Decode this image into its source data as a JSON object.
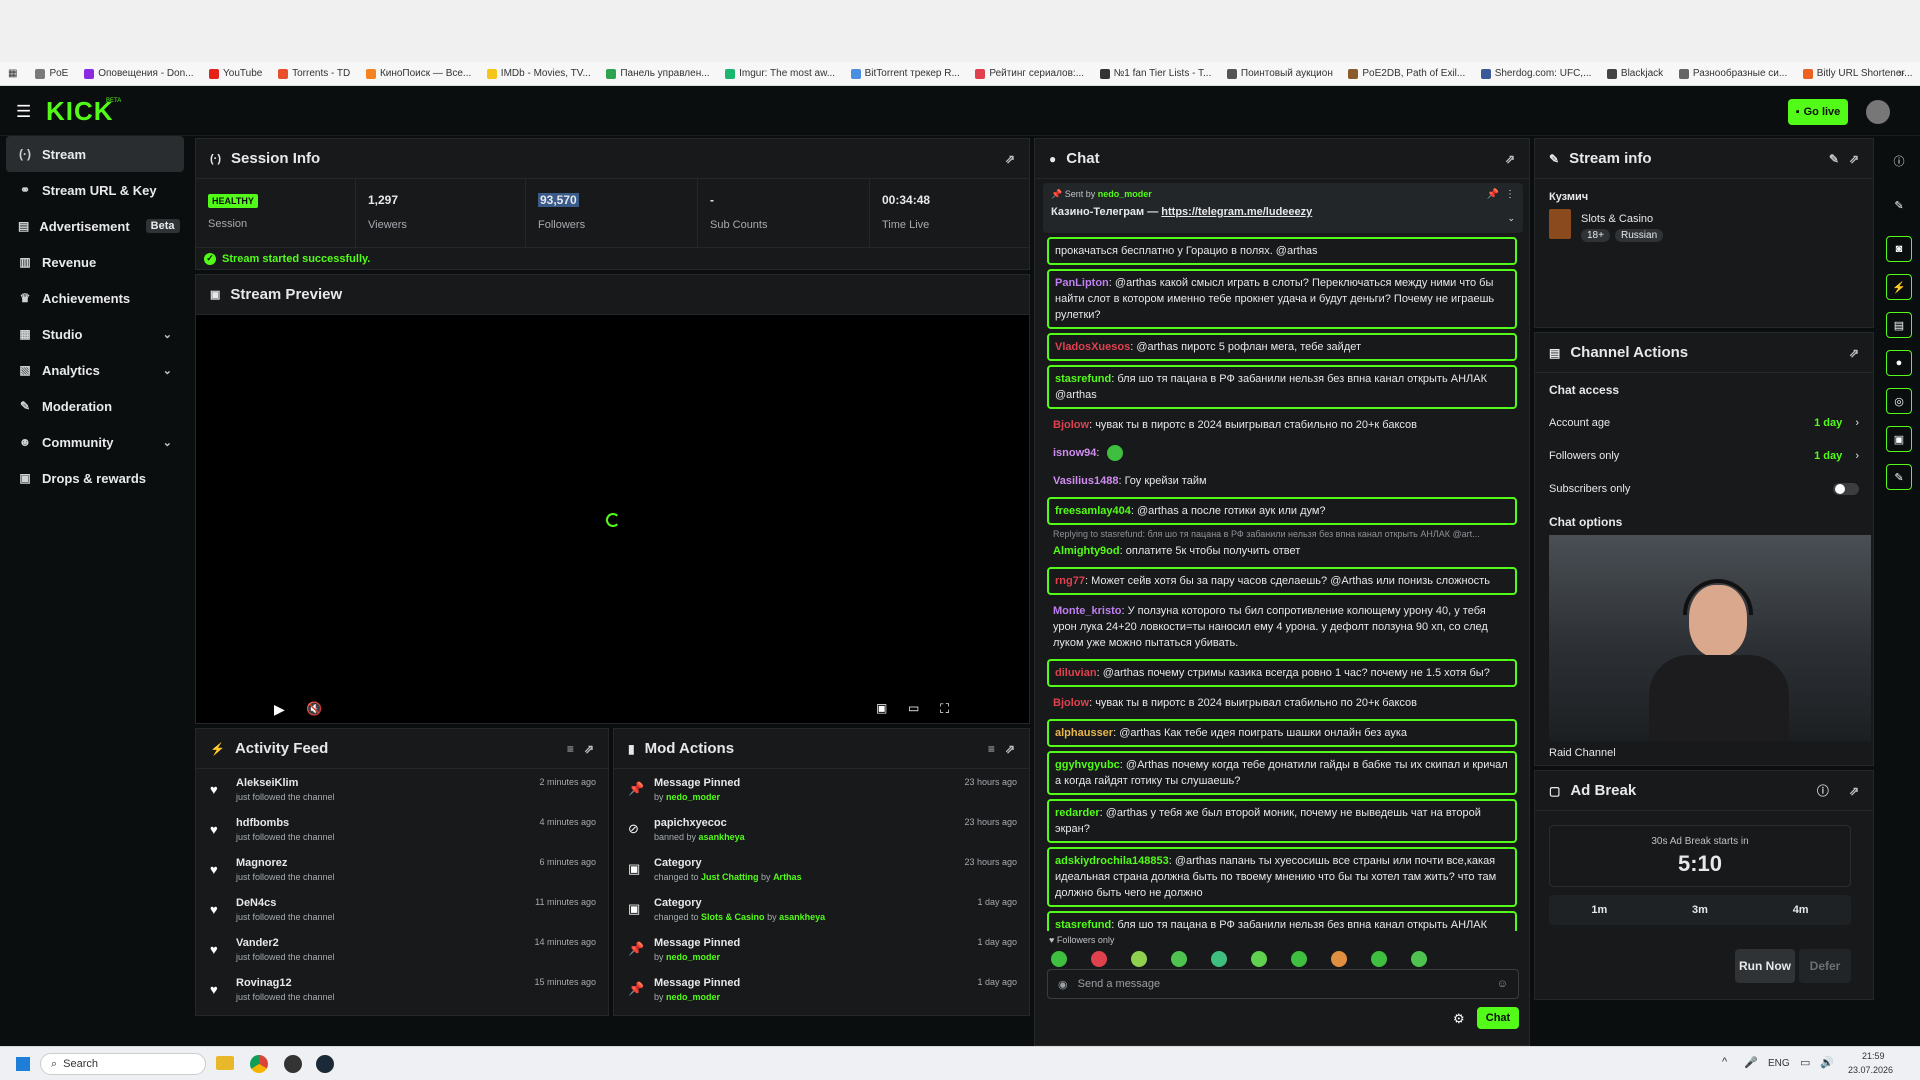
{
  "bookmarks": [
    "PoE",
    "Оповещения - Don...",
    "YouTube",
    "Torrents - TD",
    "КиноПоиск — Все...",
    "IMDb - Movies, TV...",
    "Панель управлен...",
    "Imgur: The most aw...",
    "BitTorrent трекер R...",
    "Рейтинг сериалов:...",
    "№1 fan Tier Lists - T...",
    "Поинтовый аукцион",
    "PoE2DB, Path of Exil...",
    "Sherdog.com: UFC,...",
    "Blackjack",
    "Разнообразные си...",
    "Bitly URL Shortener..."
  ],
  "colors": {
    "accent": "#53fc18",
    "panel": "#17191b",
    "bg": "#0b0e0f"
  },
  "header": {
    "logo": "KICK",
    "beta_tag": "BETA",
    "go_live": "Go live"
  },
  "sidebar": {
    "items": [
      {
        "label": "Stream",
        "icon": "broadcast-icon",
        "active": true
      },
      {
        "label": "Stream URL & Key",
        "icon": "link-icon"
      },
      {
        "label": "Advertisement",
        "icon": "ad-icon",
        "badge": "Beta"
      },
      {
        "label": "Revenue",
        "icon": "chart-icon"
      },
      {
        "label": "Achievements",
        "icon": "trophy-icon"
      },
      {
        "label": "Studio",
        "icon": "studio-icon",
        "expandable": true
      },
      {
        "label": "Analytics",
        "icon": "analytics-icon",
        "expandable": true
      },
      {
        "label": "Moderation",
        "icon": "wrench-icon"
      },
      {
        "label": "Community",
        "icon": "users-icon",
        "expandable": true
      },
      {
        "label": "Drops & rewards",
        "icon": "gift-icon"
      }
    ]
  },
  "session": {
    "title": "Session Info",
    "status": "HEALTHY",
    "status_label": "Session",
    "viewers": "1,297",
    "viewers_label": "Viewers",
    "followers": "93,570",
    "followers_label": "Followers",
    "subs": "-",
    "subs_label": "Sub Counts",
    "time_live": "00:34:48",
    "time_label": "Time Live",
    "notice": "Stream started successfully."
  },
  "preview": {
    "title": "Stream Preview"
  },
  "activity": {
    "title": "Activity Feed",
    "items": [
      {
        "name": "AlekseiKlim",
        "sub": "just followed the channel",
        "time": "2 minutes ago"
      },
      {
        "name": "hdfbombs",
        "sub": "just followed the channel",
        "time": "4 minutes ago"
      },
      {
        "name": "Magnorez",
        "sub": "just followed the channel",
        "time": "6 minutes ago"
      },
      {
        "name": "DeN4cs",
        "sub": "just followed the channel",
        "time": "11 minutes ago"
      },
      {
        "name": "Vander2",
        "sub": "just followed the channel",
        "time": "14 minutes ago"
      },
      {
        "name": "Rovinag12",
        "sub": "just followed the channel",
        "time": "15 minutes ago"
      }
    ]
  },
  "mod": {
    "title": "Mod Actions",
    "items": [
      {
        "title": "Message Pinned",
        "pre": "by ",
        "hl": "nedo_moder",
        "mid": "",
        "hl2": "",
        "time": "23 hours ago",
        "icon": "pin-icon"
      },
      {
        "title": "papichxyecoc",
        "pre": "banned by ",
        "hl": "asankheya",
        "mid": "",
        "hl2": "",
        "time": "23 hours ago",
        "icon": "ban-icon"
      },
      {
        "title": "Category",
        "pre": "changed to ",
        "hl": "Just Chatting",
        "mid": " by ",
        "hl2": "Arthas",
        "time": "23 hours ago",
        "icon": "category-icon"
      },
      {
        "title": "Category",
        "pre": "changed to ",
        "hl": "Slots & Casino",
        "mid": " by ",
        "hl2": "asankheya",
        "time": "1 day ago",
        "icon": "category-icon"
      },
      {
        "title": "Message Pinned",
        "pre": "by ",
        "hl": "nedo_moder",
        "mid": "",
        "hl2": "",
        "time": "1 day ago",
        "icon": "pin-icon"
      },
      {
        "title": "Message Pinned",
        "pre": "by ",
        "hl": "nedo_moder",
        "mid": "",
        "hl2": "",
        "time": "1 day ago",
        "icon": "pin-icon"
      }
    ]
  },
  "chat": {
    "title": "Chat",
    "pinned_by_label": "Sent by",
    "pinned_by": "nedo_moder",
    "pinned_text": "Казино-Телеграм — ",
    "pinned_link": "https://telegram.me/ludeeezy",
    "messages": [
      {
        "user": "",
        "color": "#ffffff",
        "text": "прокачаться бесплатно у Горацио в полях. @arthas",
        "hl": true
      },
      {
        "user": "PanLipton",
        "color": "#c07ff0",
        "text": "@arthas какой смысл играть в слоты? Переключаться между ними что бы найти слот в котором именно тебе прокнет удача и будут деньги? Почему не играешь рулетки?",
        "hl": true
      },
      {
        "user": "VladosXuesos",
        "color": "#e0414f",
        "text": "@arthas пиротс 5 рофлан мега, тебе зайдет",
        "hl": true
      },
      {
        "user": "stasrefund",
        "color": "#53fc18",
        "text": "бля шо тя пацана в РФ забанили нельзя без впна канал открыть АНЛАК @arthas",
        "hl": true
      },
      {
        "user": "Bjolow",
        "color": "#e0414f",
        "text": "чувак ты в пиротс в 2024 выигрывал стабильно по 20+к баксов",
        "hl": false
      },
      {
        "user": "isnow94",
        "color": "#d18cf0",
        "text": "",
        "hl": false
      },
      {
        "user": "Vasilius1488",
        "color": "#d18cf0",
        "text": "Гоу крейзи тайм",
        "hl": false
      },
      {
        "user": "freesamlay404",
        "color": "#53fc18",
        "text": "@arthas а после готики аук или дум?",
        "hl": true
      },
      {
        "user": "Almighty9od",
        "color": "#53fc18",
        "text": "оплатите 5к чтобы получить ответ",
        "hl": false,
        "reply": "Replying to stasrefund: бля шо тя пацана в РФ забанили нельзя без впна канал открыть АНЛАК @art..."
      },
      {
        "user": "rng77",
        "color": "#e0414f",
        "text": "Может сейв хотя бы за пару часов сделаешь? @Arthas или понизь сложность",
        "hl": true
      },
      {
        "user": "Monte_kristo",
        "color": "#c07ff0",
        "text": "У ползуна которого ты бил сопротивление колющему урону 40, у тебя урон лука 24+20 ловкости=ты наносил ему 4 урона. у дефолт ползуна 90 хп, со след луком уже можно пытаться убивать.",
        "hl": false
      },
      {
        "user": "diluvian",
        "color": "#e0414f",
        "text": "@arthas почему стримы казика всегда ровно 1 час? почему не 1.5 хотя бы?",
        "hl": true
      },
      {
        "user": "Bjolow",
        "color": "#e0414f",
        "text": "чувак ты в пиротс в 2024 выигрывал стабильно по 20+к баксов",
        "hl": false
      },
      {
        "user": "alphausser",
        "color": "#e8b84a",
        "text": "@arthas Как тебе идея поиграть шашки онлайн без аука",
        "hl": true
      },
      {
        "user": "ggyhvgyubc",
        "color": "#53fc18",
        "text": "@Arthas почему когда тебе донатили гайды в бабке ты их скипал и кричал а когда гайдят готику ты слушаешь?",
        "hl": true
      },
      {
        "user": "redarder",
        "color": "#53fc18",
        "text": "@arthas у тебя же был второй моник, почему не выведешь чат на второй экран?",
        "hl": true
      },
      {
        "user": "adskiydrochila148853",
        "color": "#53fc18",
        "text": "@arthas папань ты хуесосишь все страны или почти все,какая идеальная страна должна быть по твоему мнению что бы ты хотел там жить? что там должно быть чего не должно",
        "hl": true
      },
      {
        "user": "stasrefund",
        "color": "#53fc18",
        "text": "бля шо тя пацана в РФ забанили нельзя без впна канал открыть АНЛАК @arthas",
        "hl": true
      },
      {
        "user": "PanLipton",
        "color": "#e0414f",
        "text": "@arthas какой смысл играть в слоты? Переключаться между ними что бы найти слот в котором именно тебе прокнет удача и будут деньги? Почему не играешь рулетки?",
        "hl": true
      }
    ],
    "followers_only": "Followers only",
    "placeholder": "Send a message",
    "send": "Chat"
  },
  "streaminfo": {
    "title": "Stream info",
    "streamer": "Кузмич",
    "category": "Slots & Casino",
    "tag1": "18+",
    "tag2": "Russian"
  },
  "channel": {
    "title": "Channel Actions",
    "chat_access": "Chat access",
    "account_age": "Account age",
    "account_age_val": "1 day",
    "followers_only": "Followers only",
    "followers_only_val": "1 day",
    "subs_only": "Subscribers only",
    "chat_options": "Chat options",
    "raid": "Raid Channel"
  },
  "ad": {
    "title": "Ad Break",
    "starts": "30s Ad Break starts in",
    "countdown": "5:10",
    "opt1": "1m",
    "opt2": "3m",
    "opt3": "4m",
    "run": "Run Now",
    "defer": "Defer"
  },
  "taskbar": {
    "search": "Search",
    "lang": "ENG",
    "time": "21:59",
    "date": "23.07.2026"
  }
}
